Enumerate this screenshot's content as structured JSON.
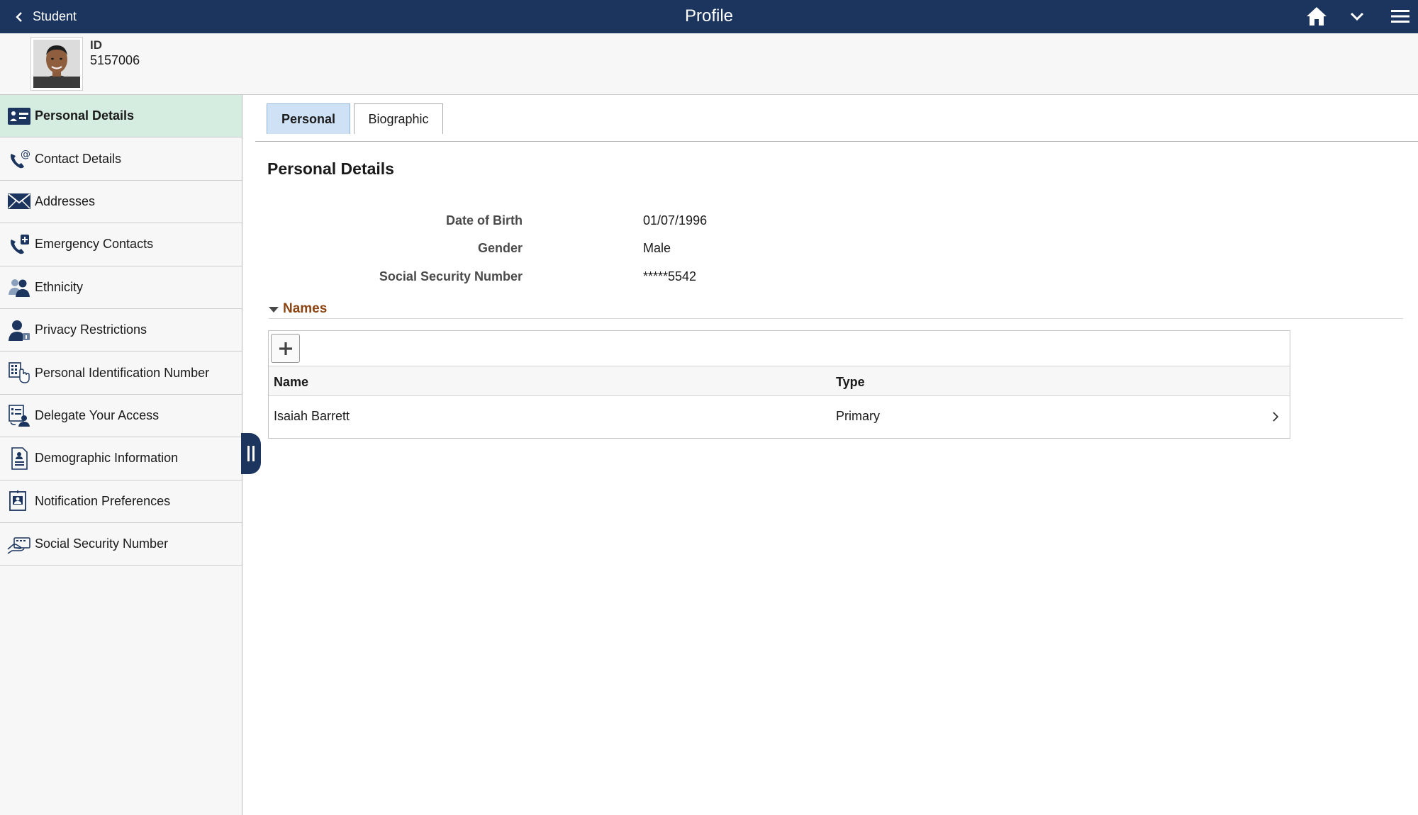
{
  "banner": {
    "back_label": "Student",
    "title": "Profile"
  },
  "student": {
    "id_label": "ID",
    "id_value": "5157006"
  },
  "sidebar": {
    "items": [
      {
        "label": "Personal Details",
        "icon": "id-card-icon",
        "active": true
      },
      {
        "label": "Contact Details",
        "icon": "phone-at-icon"
      },
      {
        "label": "Addresses",
        "icon": "envelope-icon"
      },
      {
        "label": "Emergency Contacts",
        "icon": "phone-plus-icon"
      },
      {
        "label": "Ethnicity",
        "icon": "people-icon"
      },
      {
        "label": "Privacy Restrictions",
        "icon": "person-lock-icon"
      },
      {
        "label": "Personal Identification Number",
        "icon": "keypad-hand-icon"
      },
      {
        "label": "Delegate Your Access",
        "icon": "delegate-icon"
      },
      {
        "label": "Demographic Information",
        "icon": "document-person-icon"
      },
      {
        "label": "Notification Preferences",
        "icon": "notification-icon"
      },
      {
        "label": "Social Security Number",
        "icon": "card-hand-icon"
      }
    ]
  },
  "tabs": [
    {
      "label": "Personal",
      "active": true
    },
    {
      "label": "Biographic",
      "active": false
    }
  ],
  "main": {
    "section_title": "Personal Details",
    "fields": [
      {
        "label": "Date of Birth",
        "value": "01/07/1996"
      },
      {
        "label": "Gender",
        "value": "Male"
      },
      {
        "label": "Social Security Number",
        "value": "*****5542"
      }
    ],
    "names_group": {
      "title": "Names",
      "columns": [
        "Name",
        "Type"
      ],
      "rows": [
        {
          "name": "Isaiah Barrett",
          "type": "Primary"
        }
      ]
    }
  },
  "colors": {
    "banner": "#1b355e",
    "active_nav": "#d5ece0",
    "active_tab": "#cfe2f5",
    "group_title": "#8b4513"
  }
}
